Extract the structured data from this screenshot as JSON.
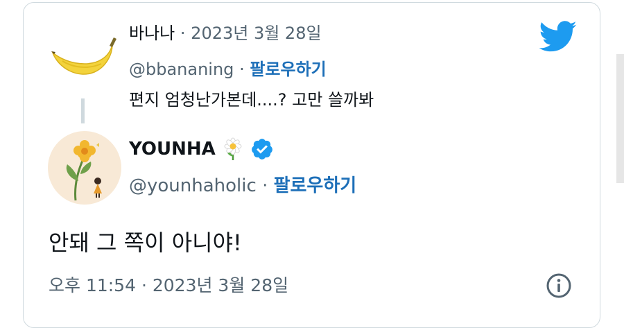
{
  "parent_tweet": {
    "display_name": "바나나",
    "date": "2023년 3월 28일",
    "handle": "@bbananing",
    "follow_label": "팔로우하기",
    "text": "편지 엄청난가본데....? 고만 쓸까봐",
    "avatar_icon": "banana-icon"
  },
  "main_tweet": {
    "display_name": "YOUNHA",
    "handle": "@younhaholic",
    "follow_label": "팔로우하기",
    "text": "안돼 그 쪽이 아니야!",
    "time": "오후 11:54",
    "date": "2023년 3월 28일",
    "avatar_icon": "flower-girl-illustration",
    "name_emoji": "daisy-icon",
    "verified_icon": "verified-badge-icon"
  },
  "separator": "·",
  "colors": {
    "twitter_blue": "#1d9bf0",
    "follow_link": "#1d6fb8",
    "muted_text": "#536471",
    "border": "#cfd9de"
  }
}
